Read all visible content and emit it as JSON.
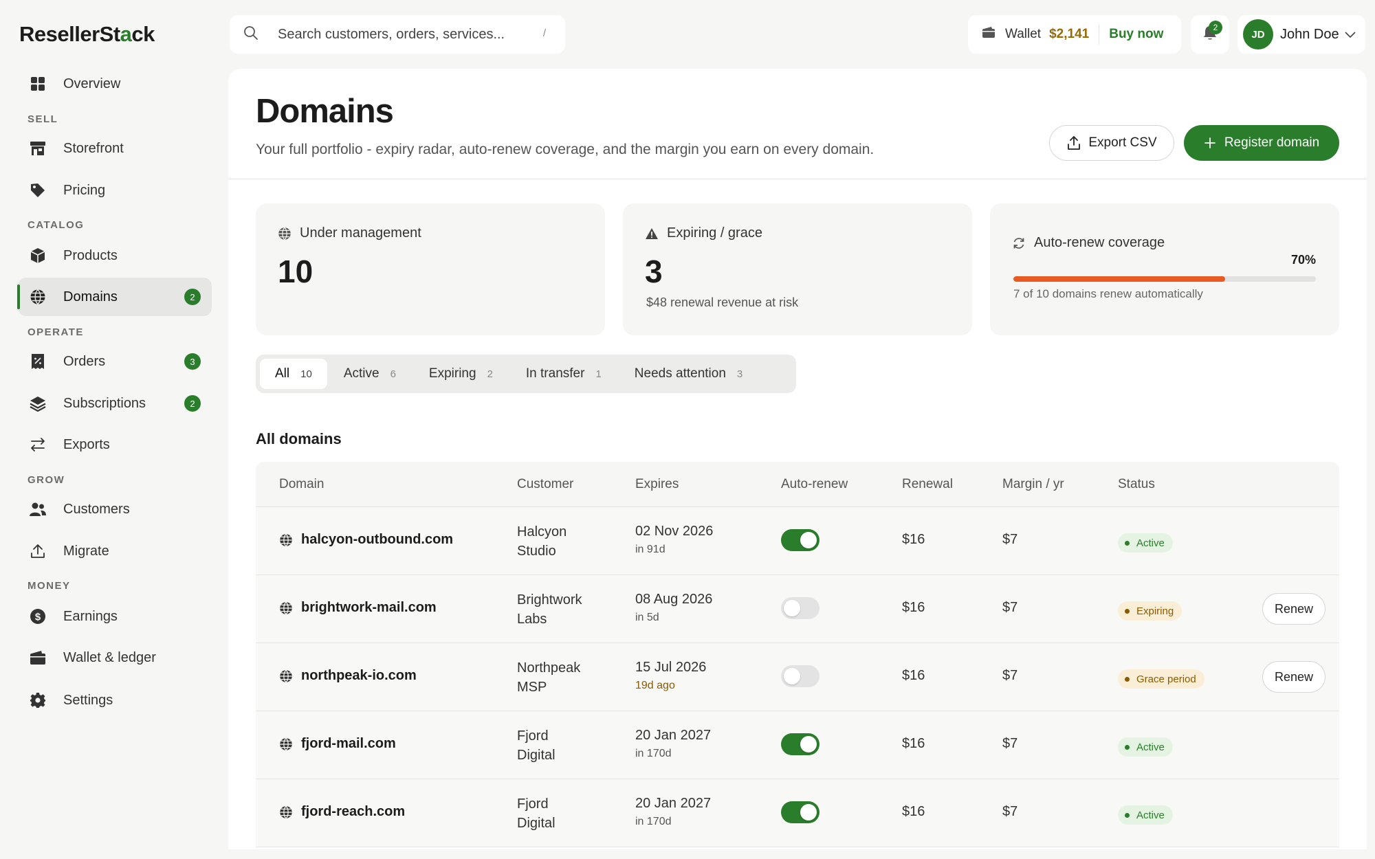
{
  "app": {
    "logo_main": "ResellerSt",
    "logo_accent": "a",
    "logo_end": "ck"
  },
  "sidebar": {
    "overview": "Overview",
    "sections": {
      "sell": "SELL",
      "catalog": "CATALOG",
      "operate": "OPERATE",
      "grow": "GROW",
      "money": "MONEY"
    },
    "items": {
      "storefront": "Storefront",
      "pricing": "Pricing",
      "products": "Products",
      "domains": "Domains",
      "domains_badge": "2",
      "orders": "Orders",
      "orders_badge": "3",
      "subscriptions": "Subscriptions",
      "subscriptions_badge": "2",
      "exports": "Exports",
      "customers": "Customers",
      "migrate": "Migrate",
      "earnings": "Earnings",
      "wallet_ledger": "Wallet & ledger",
      "settings": "Settings"
    }
  },
  "topbar": {
    "search_placeholder": "Search customers, orders, services...",
    "search_shortcut": "/",
    "wallet_label": "Wallet",
    "wallet_amount": "$2,141",
    "buy_now": "Buy now",
    "notifications_count": "2",
    "user_initials": "JD",
    "user_name": "John Doe"
  },
  "header": {
    "title": "Domains",
    "subtitle": "Your full portfolio - expiry radar, auto-renew coverage, and the margin you earn on every domain.",
    "export_label": "Export CSV",
    "register_label": "Register domain"
  },
  "stats": {
    "managed_label": "Under management",
    "managed_value": "10",
    "expiring_label": "Expiring / grace",
    "expiring_value": "3",
    "expiring_note": "$48 renewal revenue at risk",
    "autorenew_label": "Auto-renew coverage",
    "autorenew_pct": "70%",
    "autorenew_fraction": 0.7,
    "autorenew_note": "7 of 10 domains renew automatically"
  },
  "filters": [
    {
      "label": "All",
      "count": "10"
    },
    {
      "label": "Active",
      "count": "6"
    },
    {
      "label": "Expiring",
      "count": "2"
    },
    {
      "label": "In transfer",
      "count": "1"
    },
    {
      "label": "Needs attention",
      "count": "3"
    }
  ],
  "table": {
    "section_title": "All domains",
    "columns": [
      "Domain",
      "Customer",
      "Expires",
      "Auto-renew",
      "Renewal",
      "Margin / yr",
      "Status"
    ],
    "rows": [
      {
        "domain": "halcyon-outbound.com",
        "customer_line1": "Halcyon",
        "customer_line2": "Studio",
        "expires": "02 Nov 2026",
        "relative": "in 91d",
        "auto_renew": true,
        "renewal": "$16",
        "margin": "$7",
        "status": "Active",
        "renew_label": ""
      },
      {
        "domain": "brightwork-mail.com",
        "customer_line1": "Brightwork",
        "customer_line2": "Labs",
        "expires": "08 Aug 2026",
        "relative": "in 5d",
        "auto_renew": false,
        "renewal": "$16",
        "margin": "$7",
        "status": "Expiring",
        "renew_label": "Renew"
      },
      {
        "domain": "northpeak-io.com",
        "customer_line1": "Northpeak",
        "customer_line2": "MSP",
        "expires": "15 Jul 2026",
        "relative": "19d ago",
        "auto_renew": false,
        "renewal": "$16",
        "margin": "$7",
        "status": "Grace period",
        "renew_label": "Renew"
      },
      {
        "domain": "fjord-mail.com",
        "customer_line1": "Fjord",
        "customer_line2": "Digital",
        "expires": "20 Jan 2027",
        "relative": "in 170d",
        "auto_renew": true,
        "renewal": "$16",
        "margin": "$7",
        "status": "Active",
        "renew_label": ""
      },
      {
        "domain": "fjord-reach.com",
        "customer_line1": "Fjord",
        "customer_line2": "Digital",
        "expires": "20 Jan 2027",
        "relative": "in 170d",
        "auto_renew": true,
        "renewal": "$16",
        "margin": "$7",
        "status": "Active",
        "renew_label": ""
      }
    ]
  },
  "colors": {
    "accent": "#2a7d2a",
    "progress": "#e85b20",
    "warning": "#8a5a00"
  }
}
